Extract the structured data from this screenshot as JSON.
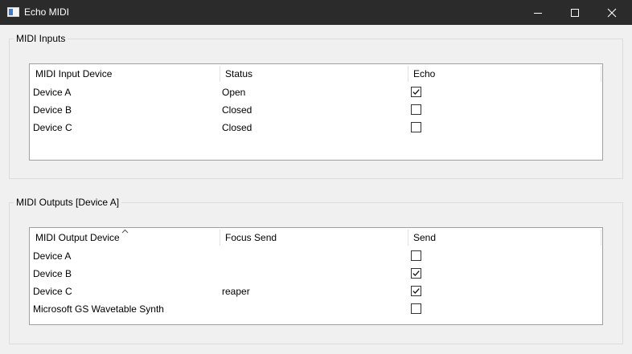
{
  "window": {
    "title": "Echo MIDI",
    "app_icon": "window-app-icon",
    "controls": [
      "minimize-icon",
      "maximize-icon",
      "close-icon"
    ]
  },
  "inputs_group": {
    "title": "MIDI Inputs",
    "columns": [
      "MIDI Input Device",
      "Status",
      "Echo"
    ],
    "rows": [
      {
        "device": "Device A",
        "status": "Open",
        "echo": true
      },
      {
        "device": "Device B",
        "status": "Closed",
        "echo": false
      },
      {
        "device": "Device C",
        "status": "Closed",
        "echo": false
      }
    ]
  },
  "outputs_group": {
    "title": "MIDI Outputs [Device A]",
    "columns": [
      "MIDI Output Device",
      "Focus Send",
      "Send"
    ],
    "sort_indicator": "sort-ascending-icon",
    "rows": [
      {
        "device": "Device A",
        "focus_send": "",
        "send": false
      },
      {
        "device": "Device B",
        "focus_send": "",
        "send": true
      },
      {
        "device": "Device C",
        "focus_send": "reaper",
        "send": true
      },
      {
        "device": "Microsoft GS Wavetable Synth",
        "focus_send": "",
        "send": false
      }
    ]
  }
}
